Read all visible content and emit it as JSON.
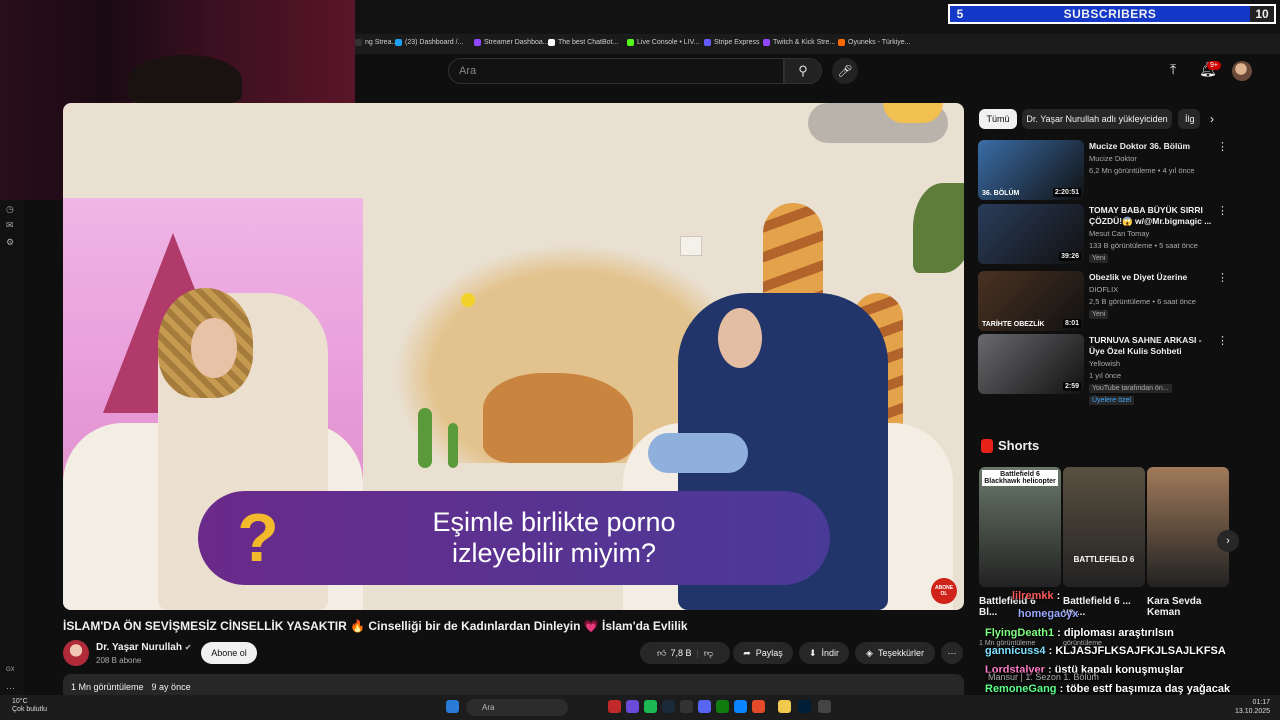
{
  "overlay": {
    "subs_left": "5",
    "subs_label": "SUBSCRIBERS",
    "subs_right": "10"
  },
  "bookmarks": [
    {
      "label": "ng Strea...",
      "color": "#333"
    },
    {
      "label": "(23) Dashboard /...",
      "color": "#1da1f2"
    },
    {
      "label": "Streamer Dashboa...",
      "color": "#9146ff"
    },
    {
      "label": "The best ChatBot...",
      "color": "#ffffff"
    },
    {
      "label": "Live Console • LIV...",
      "color": "#53fc18"
    },
    {
      "label": "Stripe Express",
      "color": "#635bff"
    },
    {
      "label": "Twitch & Kick Stre...",
      "color": "#9146ff"
    },
    {
      "label": "Oyuneks - Türkiye...",
      "color": "#ff6a00"
    }
  ],
  "header": {
    "search_placeholder": "Ara",
    "notif_count": "9+"
  },
  "video": {
    "caption_line1": "Eşimle birlikte porno",
    "caption_line2": "izleyebilir miyim?",
    "caption_q": "?",
    "subscribe_badge": "ABONE OL",
    "title": "İSLAM'DA ÖN SEVİŞMESİZ CİNSELLİK YASAKTIR 🔥 Cinselliği bir de Kadınlardan Dinleyin 💗 İslam'da Evlilik",
    "channel": "Dr. Yaşar Nurullah",
    "subscribers": "208 B abone",
    "subscribe_label": "Abone ol",
    "likes": "7,8 B",
    "share": "Paylaş",
    "download": "İndir",
    "thanks": "Teşekkürler",
    "views": "1 Mn görüntüleme",
    "age": "9 ay önce"
  },
  "chips": [
    "Tümü",
    "Dr. Yaşar Nurullah adlı yükleyiciden",
    "İlg"
  ],
  "recommendations": [
    {
      "title": "Mucize Doktor 36. Bölüm",
      "channel": "Mucize Doktor",
      "meta": "6,2 Mn görüntüleme • 4 yıl önce",
      "duration": "2:20:51",
      "badge": "",
      "thumb_color": "#3a6da8",
      "thumb_label": "36. BÖLÜM"
    },
    {
      "title": "TOMAY BABA BÜYÜK SIRRI ÇÖZDÜ!😱 w/@Mr.bigmagic ...",
      "channel": "Mesut Can Tomay",
      "meta": "133 B görüntüleme • 5 saat önce",
      "duration": "39:26",
      "badge": "Yeni",
      "thumb_color": "#2a3c5a",
      "thumb_label": ""
    },
    {
      "title": "Obezlik ve Diyet Üzerine",
      "channel": "DIOFLIX",
      "meta": "2,5 B görüntüleme • 6 saat önce",
      "duration": "8:01",
      "badge": "Yeni",
      "thumb_color": "#4a3222",
      "thumb_label": "TARİHTE OBEZLİK"
    },
    {
      "title": "TURNUVA SAHNE ARKASI - Üye Özel Kulis Sohbeti",
      "channel": "Yellowish",
      "meta": "1 yıl önce",
      "duration": "2:59",
      "badge": "YouTube tarafından ön...",
      "members": "Üyelere özel",
      "thumb_color": "#6a6a6e",
      "thumb_label": ""
    }
  ],
  "shorts": {
    "heading": "Shorts",
    "items": [
      {
        "title": "Battlefield 6 Bl...",
        "thumb_text": "Battlefield 6\nBlackhawk helicopter",
        "views": "1 Mn görüntüleme",
        "color": "#6b7a6a"
      },
      {
        "title": "Battlefield 6 ... vs ...",
        "thumb_text": "BATTLEFIELD 6",
        "views": "görüntüleme",
        "color": "#5a5040"
      },
      {
        "title": "Kara Sevda Keman",
        "thumb_text": "",
        "views": "",
        "color": "#a07a5a"
      }
    ]
  },
  "chat": [
    {
      "user": "lilremkk",
      "msg": ":",
      "color": "#ff5a5a"
    },
    {
      "user": "homegacyx",
      "msg": "",
      "color": "#9aa8ff"
    },
    {
      "user": "FlyingDeath1",
      "msg": ": diploması araştırılsın",
      "color": "#7fff7f"
    },
    {
      "user": "gannicuss4",
      "msg": ": KLJASJFLKSAJFKJLSAJLKFSA",
      "color": "#7fe0ff"
    },
    {
      "user": "Lordstalyer",
      "msg": ": üstü kapalı konuşmuşlar",
      "color": "#ff7fc8"
    },
    {
      "user": "RemoneGang",
      "msg": ": töbe estf başımıza daş yağacak",
      "color": "#5aff8a"
    }
  ],
  "chat_extra": {
    "mansur": "Mansur | 1. Sezon 1. Bölüm"
  },
  "taskbar": {
    "weather_temp": "10°C",
    "weather_desc": "Çok bulutlu",
    "search": "Ara",
    "time": "01:17",
    "date": "13.10.2025"
  },
  "left_strip": {
    "gx": "GX"
  }
}
